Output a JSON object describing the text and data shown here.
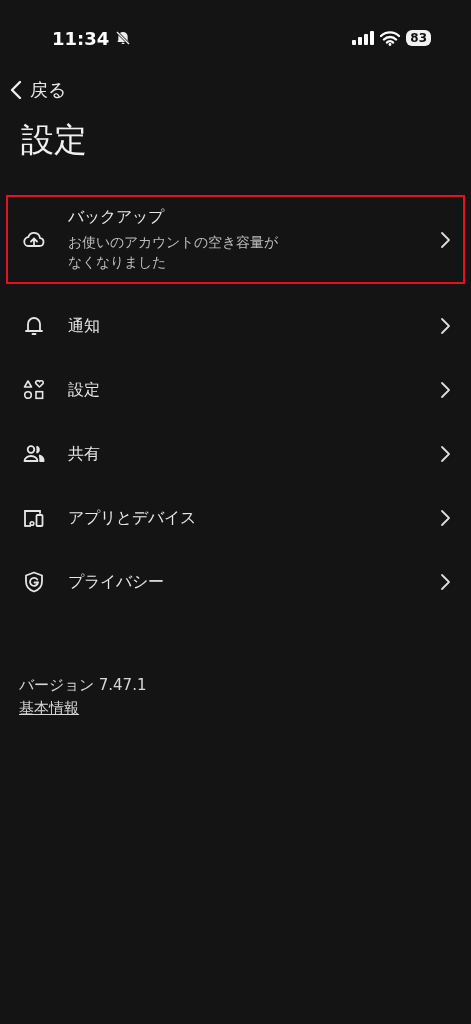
{
  "status_bar": {
    "time": "11:34",
    "battery": "83"
  },
  "back": {
    "label": "戻る"
  },
  "title": "設定",
  "items": [
    {
      "label": "バックアップ",
      "subtitle": "お使いのアカウントの空き容量がなくなりました",
      "highlighted": true
    },
    {
      "label": "通知",
      "highlighted": false
    },
    {
      "label": "設定",
      "highlighted": false
    },
    {
      "label": "共有",
      "highlighted": false
    },
    {
      "label": "アプリとデバイス",
      "highlighted": false
    },
    {
      "label": "プライバシー",
      "highlighted": false
    }
  ],
  "version": "バージョン 7.47.1",
  "info_link": "基本情報"
}
